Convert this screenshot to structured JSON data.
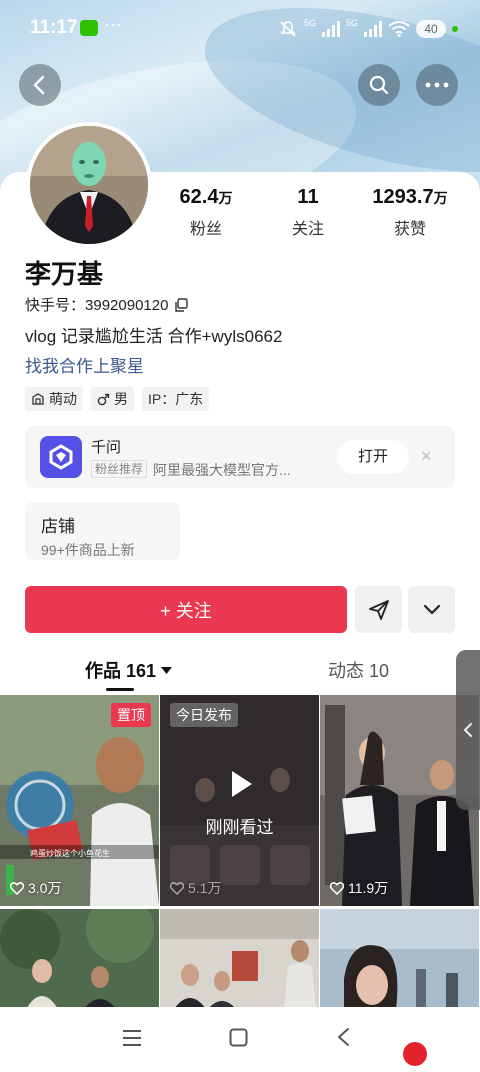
{
  "status_bar": {
    "time": "11:17",
    "more_dots": "···",
    "signal_5g_1": "5G",
    "signal_5g_2": "5G",
    "battery": "40"
  },
  "profile": {
    "name": "李万基",
    "id_label": "快手号：",
    "id_value": "3992090120",
    "bio": "vlog 记录尴尬生活 合作+wyls0662",
    "link": "找我合作上聚星",
    "stats": [
      {
        "num": "62.4",
        "unit": "万",
        "label": "粉丝"
      },
      {
        "num": "11",
        "unit": "",
        "label": "关注"
      },
      {
        "num": "1293.7",
        "unit": "万",
        "label": "获赞"
      }
    ],
    "tags": [
      {
        "icon": "cute-icon",
        "text": "萌动"
      },
      {
        "icon": "male-icon",
        "text": "男"
      },
      {
        "icon": "",
        "text": "IP：广东"
      }
    ]
  },
  "recommend": {
    "title": "千问",
    "badge": "粉丝推荐",
    "desc": "阿里最强大模型官方...",
    "open_label": "打开",
    "close_label": "×"
  },
  "shop": {
    "title": "店铺",
    "subtitle": "99+件商品上新"
  },
  "actions": {
    "follow_label": "+ 关注"
  },
  "tabs": [
    {
      "label": "作品 161",
      "active": true
    },
    {
      "label": "动态 10",
      "active": false
    }
  ],
  "videos": [
    {
      "likes": "3.0万",
      "pinned": "置顶",
      "tag": "",
      "overlay": "",
      "caption": "鸡蛋炒饭这个小鱼花生"
    },
    {
      "likes": "5.1万",
      "pinned": "",
      "tag": "今日发布",
      "overlay": "刚刚看过",
      "caption": ""
    },
    {
      "likes": "11.9万",
      "pinned": "",
      "tag": "",
      "overlay": "",
      "caption": ""
    },
    {
      "likes": "",
      "pinned": "",
      "tag": "",
      "overlay": "",
      "caption": ""
    },
    {
      "likes": "",
      "pinned": "",
      "tag": "",
      "overlay": "",
      "caption": ""
    },
    {
      "likes": "",
      "pinned": "",
      "tag": "",
      "overlay": "",
      "caption": ""
    }
  ],
  "colors": {
    "accent": "#e9384f",
    "link": "#3b5b8f",
    "rec_logo": "#5551e6"
  }
}
